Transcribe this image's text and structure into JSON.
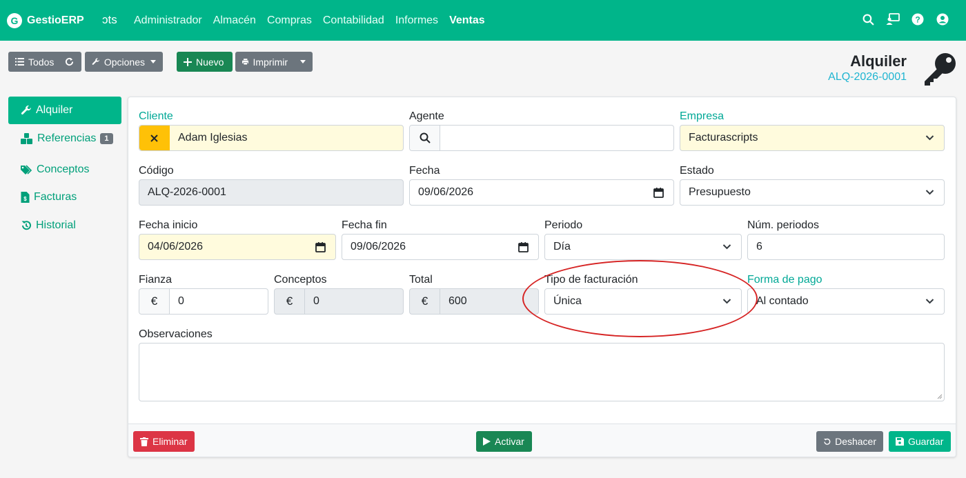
{
  "navbar": {
    "brand": "GestioERP",
    "brand_peek": "ɔts",
    "menu": [
      {
        "label": "Administrador"
      },
      {
        "label": "Almacén"
      },
      {
        "label": "Compras"
      },
      {
        "label": "Contabilidad"
      },
      {
        "label": "Informes"
      },
      {
        "label": "Ventas"
      }
    ],
    "icons": [
      "search-icon",
      "screen-user-icon",
      "help-icon",
      "user-circle-icon"
    ]
  },
  "toolbar": {
    "todos_label": "Todos",
    "opciones_label": "Opciones",
    "nuevo_label": "Nuevo",
    "imprimir_label": "Imprimir"
  },
  "header": {
    "title": "Alquiler",
    "code": "ALQ-2026-0001"
  },
  "sidebar": {
    "items": [
      {
        "label": "Alquiler",
        "icon": "wrench-icon"
      },
      {
        "label": "Referencias",
        "icon": "cubes-icon",
        "badge": "1"
      },
      {
        "label": "Conceptos",
        "icon": "tags-icon"
      },
      {
        "label": "Facturas",
        "icon": "invoice-icon"
      },
      {
        "label": "Historial",
        "icon": "history-icon"
      }
    ]
  },
  "form": {
    "cliente": {
      "label": "Cliente",
      "value": "Adam Iglesias"
    },
    "agente": {
      "label": "Agente",
      "value": ""
    },
    "empresa": {
      "label": "Empresa",
      "value": "Facturascripts"
    },
    "codigo": {
      "label": "Código",
      "value": "ALQ-2026-0001"
    },
    "fecha": {
      "label": "Fecha",
      "value": "09/06/2026"
    },
    "estado": {
      "label": "Estado",
      "value": "Presupuesto"
    },
    "fecha_inicio": {
      "label": "Fecha inicio",
      "value": "04/06/2026"
    },
    "fecha_fin": {
      "label": "Fecha fin",
      "value": "09/06/2026"
    },
    "periodo": {
      "label": "Periodo",
      "value": "Día"
    },
    "num_periodos": {
      "label": "Núm. periodos",
      "value": "6"
    },
    "fianza": {
      "label": "Fianza",
      "value": "0",
      "currency": "€"
    },
    "conceptos": {
      "label": "Conceptos",
      "value": "0",
      "currency": "€"
    },
    "total": {
      "label": "Total",
      "value": "600",
      "currency": "€"
    },
    "tipo_facturacion": {
      "label": "Tipo de facturación",
      "value": "Única"
    },
    "forma_pago": {
      "label": "Forma de pago",
      "value": "Al contado"
    },
    "observaciones": {
      "label": "Observaciones",
      "value": ""
    }
  },
  "footer": {
    "eliminar_label": "Eliminar",
    "activar_label": "Activar",
    "deshacer_label": "Deshacer",
    "guardar_label": "Guardar"
  },
  "colors": {
    "brand": "#00b58a",
    "highlight": "#d62424"
  }
}
